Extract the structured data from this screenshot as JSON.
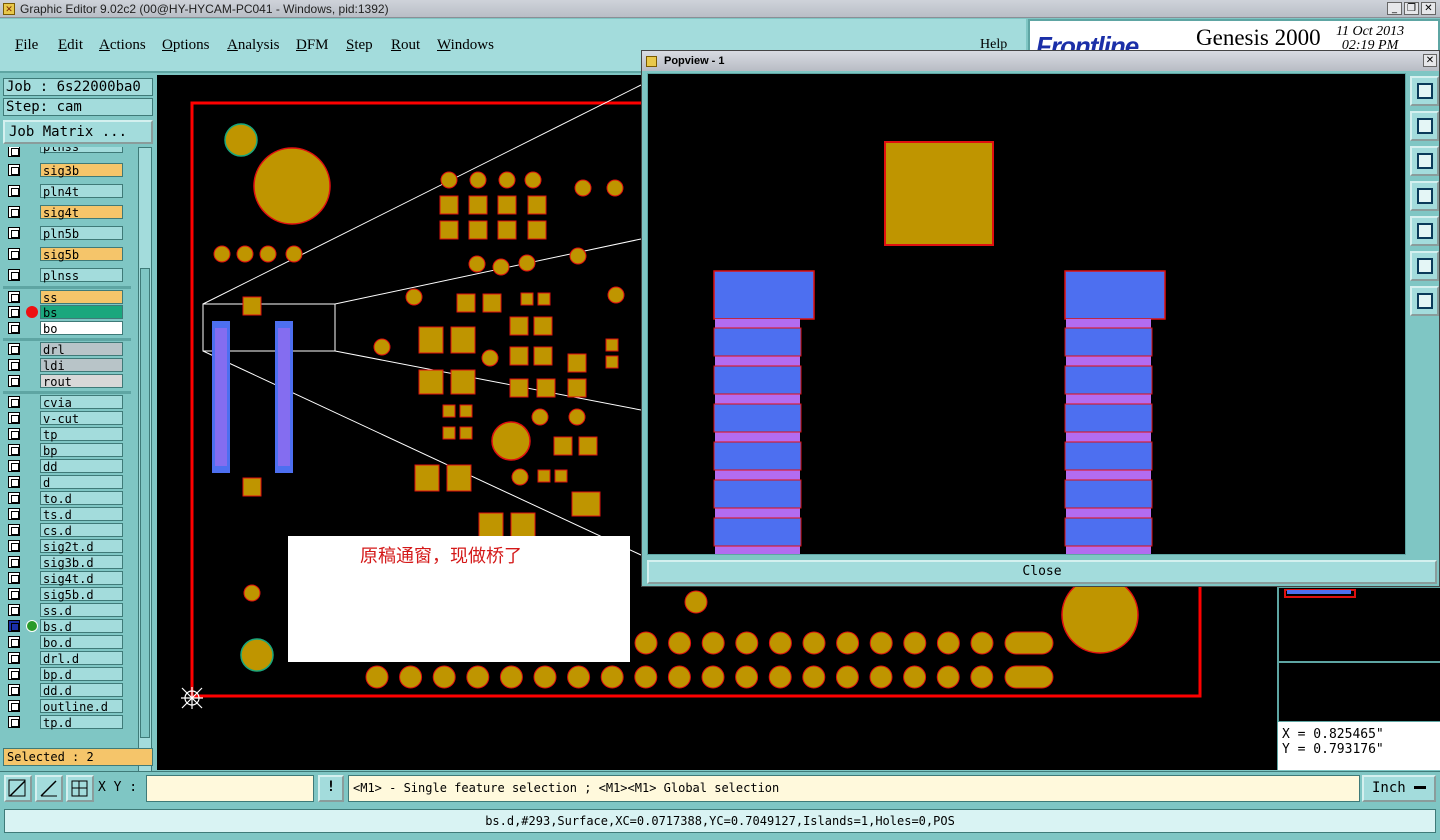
{
  "window": {
    "title": "Graphic Editor 9.02c2 (00@HY-HYCAM-PC041 - Windows, pid:1392)",
    "app_icon": "app-x-icon",
    "controls": [
      "minimize-icon",
      "restore-icon",
      "close-icon"
    ]
  },
  "menubar": {
    "items": [
      "File",
      "Edit",
      "Actions",
      "Options",
      "Analysis",
      "DFM",
      "Step",
      "Rout",
      "Windows"
    ],
    "help": "Help"
  },
  "brand": {
    "logo": "Frontline",
    "product": "Genesis 2000",
    "date": "11 Oct 2013",
    "time": "02:19 PM"
  },
  "left": {
    "job": "Job : 6s22000ba0",
    "step": "Step: cam",
    "job_matrix": "Job Matrix ...",
    "selected": "Selected : 2",
    "layers": [
      {
        "name": "plnss",
        "color": "#a3dcdc",
        "partial": true
      },
      {
        "name": "sig3b",
        "color": "#f5c56a"
      },
      {
        "name": "pln4t",
        "color": "#a3dcdc"
      },
      {
        "name": "sig4t",
        "color": "#f5c56a"
      },
      {
        "name": "pln5b",
        "color": "#a3dcdc"
      },
      {
        "name": "sig5b",
        "color": "#f5c56a"
      },
      {
        "name": "plnss",
        "color": "#a3dcdc"
      },
      {
        "name": "ss",
        "color": "#f5c56a"
      },
      {
        "name": "bs",
        "color": "#1aa77d",
        "marker": "red-dot-icon"
      },
      {
        "name": "bo",
        "color": "#ffffff"
      },
      {
        "name": "drl",
        "color": "#b8c4c8"
      },
      {
        "name": "ldi",
        "color": "#b8c4c8"
      },
      {
        "name": "rout",
        "color": "#d8d8d8"
      },
      {
        "name": "cvia",
        "color": "#a3dcdc"
      },
      {
        "name": "v-cut",
        "color": "#a3dcdc"
      },
      {
        "name": "tp",
        "color": "#a3dcdc"
      },
      {
        "name": "bp",
        "color": "#a3dcdc"
      },
      {
        "name": "dd",
        "color": "#a3dcdc"
      },
      {
        "name": "d",
        "color": "#a3dcdc"
      },
      {
        "name": "to.d",
        "color": "#a3dcdc"
      },
      {
        "name": "ts.d",
        "color": "#a3dcdc"
      },
      {
        "name": "cs.d",
        "color": "#a3dcdc"
      },
      {
        "name": "sig2t.d",
        "color": "#a3dcdc"
      },
      {
        "name": "sig3b.d",
        "color": "#a3dcdc"
      },
      {
        "name": "sig4t.d",
        "color": "#a3dcdc"
      },
      {
        "name": "sig5b.d",
        "color": "#a3dcdc"
      },
      {
        "name": "ss.d",
        "color": "#a3dcdc"
      },
      {
        "name": "bs.d",
        "color": "#a3dcdc",
        "marker": "edit-pencil-icon"
      },
      {
        "name": "bo.d",
        "color": "#a3dcdc"
      },
      {
        "name": "drl.d",
        "color": "#a3dcdc"
      },
      {
        "name": "bp.d",
        "color": "#a3dcdc"
      },
      {
        "name": "dd.d",
        "color": "#a3dcdc"
      },
      {
        "name": "outline.d",
        "color": "#a3dcdc"
      },
      {
        "name": "tp.d",
        "color": "#a3dcdc"
      }
    ]
  },
  "note": {
    "text": "原稿通窗，现做桥了"
  },
  "popview": {
    "title": "Popview - 1",
    "close_label": "Close",
    "tools": [
      "zoom-window-icon",
      "move-up-icon",
      "move-down-icon",
      "move-left-icon",
      "move-right-icon",
      "zoom-out-icon",
      "zoom-in-icon"
    ]
  },
  "coords": {
    "x": "X = 0.825465\"",
    "y": "Y = 0.793176\""
  },
  "bottom": {
    "xy_label": "X Y :",
    "xy_value": "",
    "warn": "!",
    "prompt": "<M1> - Single feature selection ; <M1><M1> Global selection",
    "units": "Inch",
    "status": "bs.d,#293,Surface,XC=0.0717388,YC=0.7049127,Islands=1,Holes=0,POS"
  },
  "colors": {
    "pad": "#bf9500",
    "pad_outline": "#e01010",
    "mask": "#4d6ff0",
    "mask_stripe": "#b36cf0",
    "board_outline": "#ff0000"
  }
}
